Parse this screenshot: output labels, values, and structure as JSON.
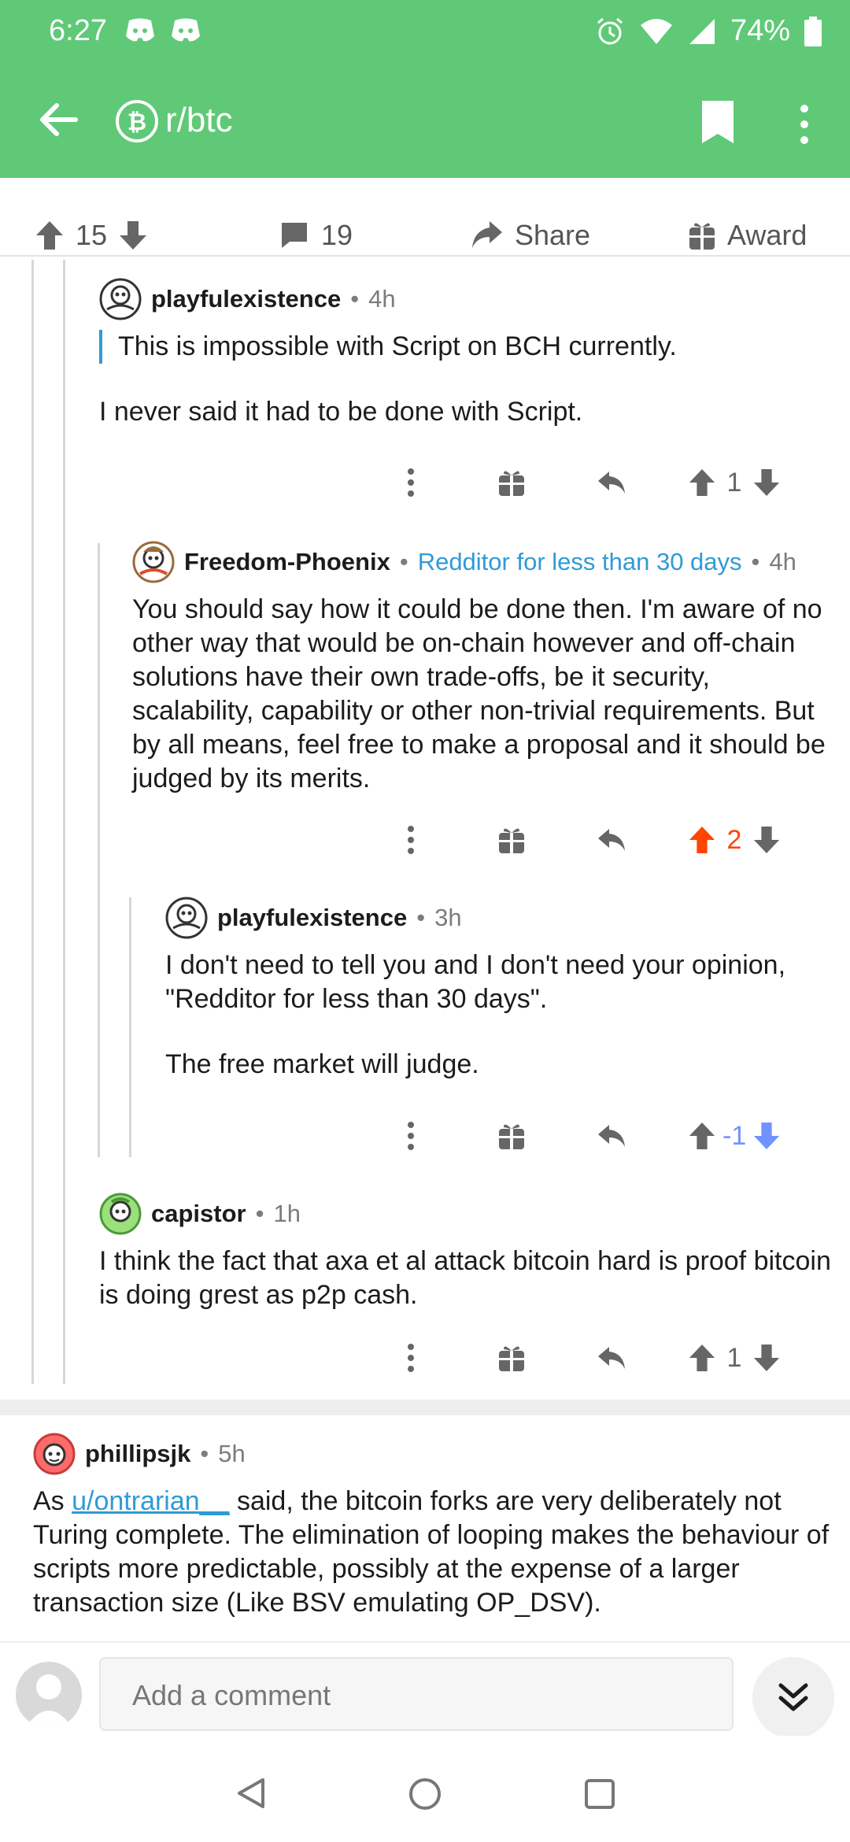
{
  "status_bar": {
    "time": "6:27",
    "battery": "74%"
  },
  "header": {
    "subreddit": "r/btc"
  },
  "post_actions": {
    "upvotes": "15",
    "comments": "19",
    "share_label": "Share",
    "award_label": "Award"
  },
  "comments": [
    {
      "user": "playfulexistence",
      "age": "4h",
      "quote": "This is impossible with Script on BCH currently.",
      "body": "I never said it had to be done with Script.",
      "score": "1"
    },
    {
      "user": "Freedom-Phoenix",
      "flair": "Redditor for less than 30 days",
      "age": "4h",
      "body": "You should say how it could be done then. I'm aware of no other way that would be on-chain however and off-chain solutions have their own trade-offs, be it security, scalability, capability or other non-trivial requirements. But by all means, feel free to make a proposal and it should be judged by its merits.",
      "score": "2"
    },
    {
      "user": "playfulexistence",
      "age": "3h",
      "body1": "I don't need to tell you and I don't need your opinion, \"Redditor for less than 30 days\".",
      "body2": "The free market will judge.",
      "score": "-1"
    },
    {
      "user": "capistor",
      "age": "1h",
      "body": "I think the fact that axa et al attack bitcoin hard is proof bitcoin is doing grest as p2p cash.",
      "score": "1"
    },
    {
      "user": "phillipsjk",
      "age": "5h",
      "body_prefix": "As ",
      "link": "u/ontrarian__",
      "body_suffix": " said, the bitcoin forks are very deliberately not Turing complete. The elimination of looping makes the behaviour of scripts more predictable, possibly at the expense of a larger transaction size (Like BSV emulating OP_DSV)."
    }
  ],
  "composer": {
    "placeholder": "Add a comment"
  },
  "colors": {
    "header_bg": "#5fc977",
    "upvoted": "#ff4500",
    "downvoted": "#7193ff",
    "flair": "#2f9bd6"
  }
}
